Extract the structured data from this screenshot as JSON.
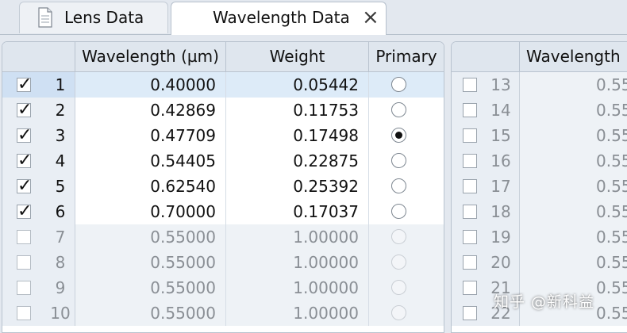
{
  "tabs": [
    {
      "label": "Lens Data",
      "active": false
    },
    {
      "label": "Wavelength Data",
      "active": true,
      "closable": true
    }
  ],
  "left_table": {
    "columns": [
      "",
      "Wavelength (µm)",
      "Weight",
      "Primary"
    ],
    "rows": [
      {
        "index": "1",
        "checked": true,
        "wavelength": "0.40000",
        "weight": "0.05442",
        "primary": false,
        "selected": true,
        "enabled": true
      },
      {
        "index": "2",
        "checked": true,
        "wavelength": "0.42869",
        "weight": "0.11753",
        "primary": false,
        "selected": false,
        "enabled": true
      },
      {
        "index": "3",
        "checked": true,
        "wavelength": "0.47709",
        "weight": "0.17498",
        "primary": true,
        "selected": false,
        "enabled": true
      },
      {
        "index": "4",
        "checked": true,
        "wavelength": "0.54405",
        "weight": "0.22875",
        "primary": false,
        "selected": false,
        "enabled": true
      },
      {
        "index": "5",
        "checked": true,
        "wavelength": "0.62540",
        "weight": "0.25392",
        "primary": false,
        "selected": false,
        "enabled": true
      },
      {
        "index": "6",
        "checked": true,
        "wavelength": "0.70000",
        "weight": "0.17037",
        "primary": false,
        "selected": false,
        "enabled": true
      },
      {
        "index": "7",
        "checked": false,
        "wavelength": "0.55000",
        "weight": "1.00000",
        "primary": false,
        "selected": false,
        "enabled": false
      },
      {
        "index": "8",
        "checked": false,
        "wavelength": "0.55000",
        "weight": "1.00000",
        "primary": false,
        "selected": false,
        "enabled": false
      },
      {
        "index": "9",
        "checked": false,
        "wavelength": "0.55000",
        "weight": "1.00000",
        "primary": false,
        "selected": false,
        "enabled": false
      },
      {
        "index": "10",
        "checked": false,
        "wavelength": "0.55000",
        "weight": "1.00000",
        "primary": false,
        "selected": false,
        "enabled": false
      }
    ]
  },
  "right_table": {
    "columns": [
      "",
      "Wavelength"
    ],
    "rows": [
      {
        "index": "13",
        "checked": false,
        "wavelength": "0.55"
      },
      {
        "index": "14",
        "checked": false,
        "wavelength": "0.55"
      },
      {
        "index": "15",
        "checked": false,
        "wavelength": "0.55"
      },
      {
        "index": "16",
        "checked": false,
        "wavelength": "0.55"
      },
      {
        "index": "17",
        "checked": false,
        "wavelength": "0.55"
      },
      {
        "index": "18",
        "checked": false,
        "wavelength": "0.55"
      },
      {
        "index": "19",
        "checked": false,
        "wavelength": "0.55"
      },
      {
        "index": "20",
        "checked": false,
        "wavelength": "0.55"
      },
      {
        "index": "21",
        "checked": false,
        "wavelength": "0.55"
      },
      {
        "index": "22",
        "checked": false,
        "wavelength": "0.55"
      }
    ]
  },
  "watermark": "知乎 @新科益",
  "icons": {
    "lens_tab": "document-icon",
    "close": "close-icon"
  },
  "colors": {
    "header_bg": "#dfe6ee",
    "selected_row": "#ddebf8",
    "disabled_cell": "#eef2f6",
    "frame": "#e3e8ef"
  }
}
